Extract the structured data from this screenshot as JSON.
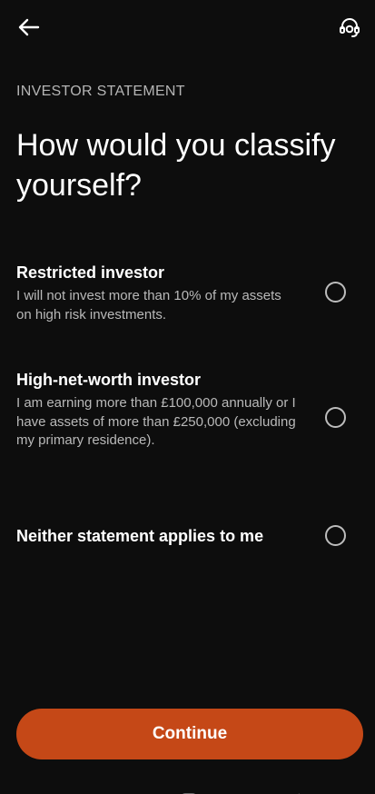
{
  "header": {
    "back_icon": "arrow-left-icon",
    "support_icon": "headset-support-icon"
  },
  "overline": "INVESTOR STATEMENT",
  "title": "How would you classify yourself?",
  "options": [
    {
      "title": "Restricted investor",
      "description": "I will not invest more than 10% of my assets on high risk investments.",
      "selected": false
    },
    {
      "title": "High-net-worth investor",
      "description": "I am earning more than £100,000 annually or I have assets of more than £250,000 (excluding my primary residence).",
      "selected": false
    },
    {
      "title": "Neither statement applies to me",
      "description": "",
      "selected": false
    }
  ],
  "continue_label": "Continue",
  "colors": {
    "background": "#0d0d0d",
    "accent": "#c54817",
    "muted_text": "#b9b9b9"
  }
}
